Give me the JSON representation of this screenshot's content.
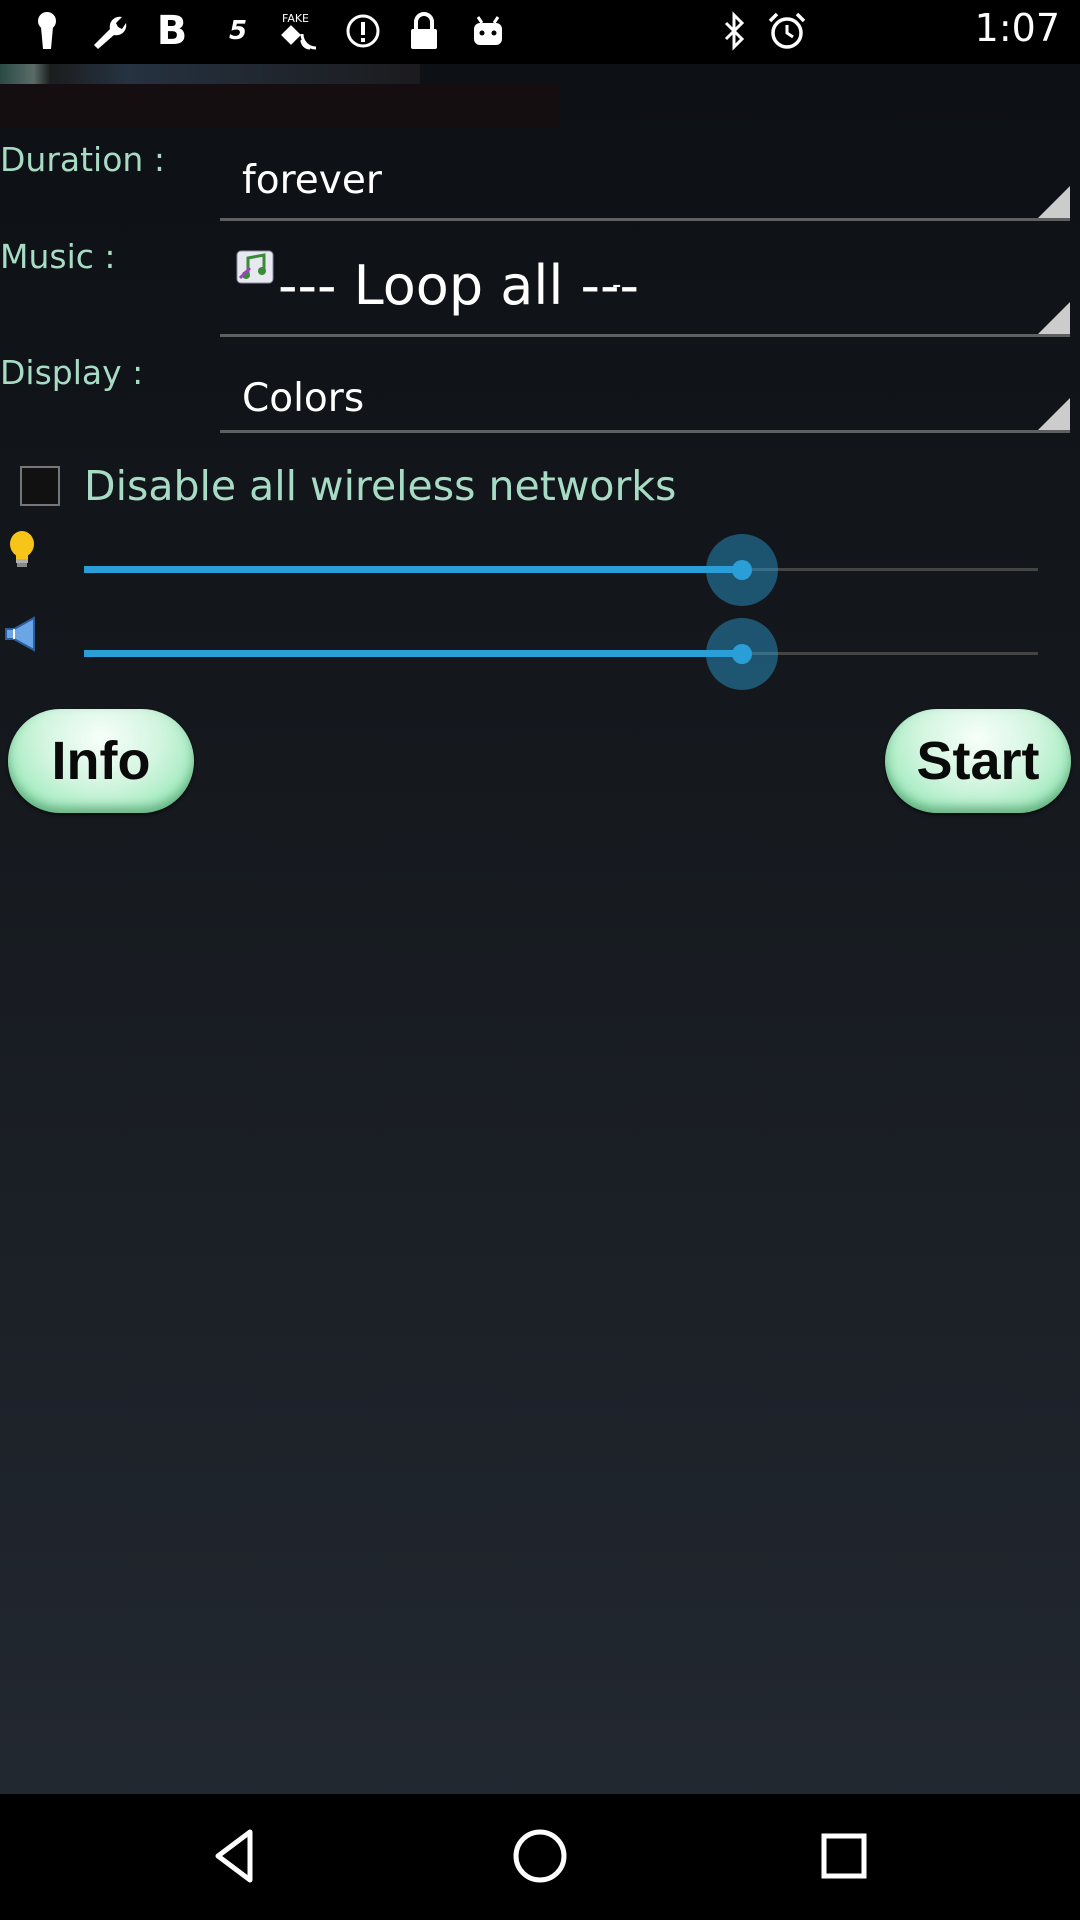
{
  "status_bar": {
    "time": "1:07",
    "icons": [
      "keyhole-icon",
      "wrench-icon",
      "bold-b-icon",
      "s-icon",
      "fake-gps-icon",
      "info-circle-icon",
      "lock-icon",
      "android-icon",
      "bluetooth-icon",
      "alarm-icon"
    ]
  },
  "form": {
    "duration": {
      "label": "Duration :",
      "value": "forever"
    },
    "music": {
      "label": "Music :",
      "value": "--- Loop all ---",
      "suffix": "-"
    },
    "display": {
      "label": "Display :",
      "value": "Colors"
    }
  },
  "wireless": {
    "label": "Disable all wireless networks",
    "checked": false
  },
  "sliders": {
    "brightness": {
      "icon": "lightbulb-icon",
      "level_percent": 69
    },
    "volume": {
      "icon": "speaker-icon",
      "level_percent": 69
    }
  },
  "buttons": {
    "info": "Info",
    "start": "Start"
  },
  "colors": {
    "label": "#a7dbc4",
    "accent": "#2a9fd7",
    "button": "#c9f3d8"
  },
  "nav": {
    "icons": [
      "back-icon",
      "home-icon",
      "recents-icon"
    ]
  }
}
